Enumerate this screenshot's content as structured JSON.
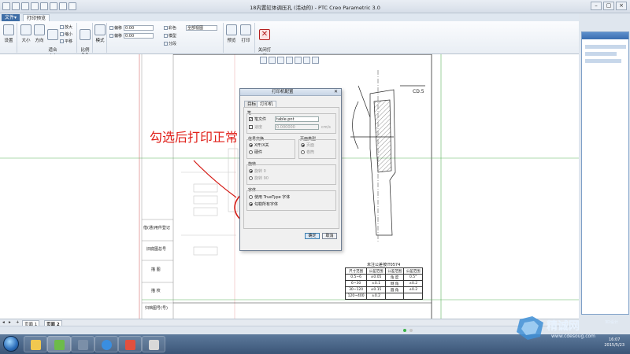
{
  "window": {
    "title": "18内置缸体调压孔 (活动的) - PTC Creo Parametric 3.0"
  },
  "ribbon": {
    "tabs": [
      "文件▾",
      "打印预览"
    ],
    "active_tab": "打印预览",
    "buttons": {
      "settings": "设置",
      "zoom": "大小",
      "direction": "方向",
      "fit": "适合\n大小",
      "zoom_in": "放大",
      "zoom_out": "缩小",
      "pan": "平移",
      "ratio": "比例\n1:1",
      "mode": "模式",
      "preview": "预览",
      "print": "打印",
      "close": "关闭打印\n预览"
    },
    "fields": {
      "offset_x_label": "偏移",
      "offset_x": "0.00",
      "offset_y_label": "偏移",
      "offset_y": "0.00",
      "view_select": "全部视图",
      "color": "彩色",
      "model": "模型",
      "sheet_count": "分段"
    },
    "group_labels": [
      "设置",
      "缩放",
      "设计",
      "显示",
      "模型",
      "完成",
      "关闭"
    ]
  },
  "annotation_text": "勾选后打印正常",
  "dialog": {
    "title": "打印机配置",
    "tabs": [
      "目标",
      "打印机"
    ],
    "active_tab": "打印机",
    "sections": {
      "pen": "笔",
      "signal": "信号交换",
      "page_type": "页面类型",
      "rotation": "旋转",
      "fonts": "字体"
    },
    "pen_file_label": "笔文件",
    "pen_file_value": "table.pnt",
    "speed_label": "速度",
    "speed_value": "0.000000",
    "speed_unit": "cm/s",
    "signal_options": [
      "X开/X关",
      "硬件"
    ],
    "signal_selected": "X开/X关",
    "page_options": [
      "页面",
      "卷筒"
    ],
    "page_selected": "页面",
    "rotation_options": [
      "旋转 0",
      "旋转 90"
    ],
    "font_options": [
      "使用 TrueType 字体",
      "勾勒所有字体"
    ],
    "font_selected": "勾勒所有字体",
    "ok": "确定",
    "cancel": "取消"
  },
  "drawing": {
    "notes": [
      "CD.5",
      "未注公差按IT0574"
    ],
    "tolerance_table": {
      "header": [
        "尺寸范围",
        "公差范围",
        "公差范围",
        "公差范围"
      ],
      "rows": [
        [
          "0.5~6",
          "±0.05",
          "角 度",
          "0.5°"
        ],
        [
          "6~30",
          "±0.1",
          "倒 角",
          "±0.2"
        ],
        [
          "30~120",
          "±0.15",
          "圆 角",
          "±0.2"
        ],
        [
          "120~400",
          "±0.2",
          "",
          ""
        ]
      ]
    },
    "side_labels": [
      "借(通)用件登记",
      "旧底图总号",
      "描 图",
      "描 校",
      "归档图号(号)"
    ]
  },
  "sheets": [
    "页面 1",
    "页面 2"
  ],
  "active_sheet": "页面 2",
  "clock": {
    "time": "16:07",
    "date": "2015/5/23"
  },
  "watermark": {
    "brand": "精诚网",
    "sub": "3D设计",
    "url": "www.cdesoug.com"
  }
}
